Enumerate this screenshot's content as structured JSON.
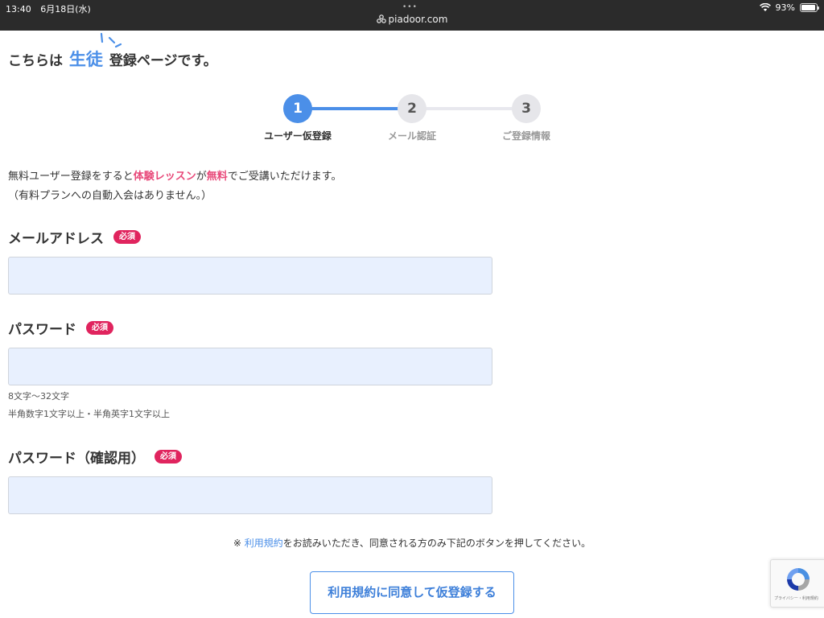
{
  "status_bar": {
    "time": "13:40",
    "date": "6月18日(水)",
    "dots": "•••",
    "url": "piadoor.com",
    "battery": "93%",
    "battery_level": 0.93
  },
  "heading": {
    "prefix": "こちらは",
    "highlight": "生徒",
    "suffix": "登録ページです。"
  },
  "stepper": {
    "current_step": 1,
    "steps": [
      {
        "number": "1",
        "label": "ユーザー仮登録"
      },
      {
        "number": "2",
        "label": "メール認証"
      },
      {
        "number": "3",
        "label": "ご登録情報"
      }
    ],
    "colors": {
      "active": "#4b8fe8",
      "inactive": "#e6e6ea"
    }
  },
  "intro": {
    "line1_a": "無料ユーザー登録をすると",
    "line1_b": "体験レッスン",
    "line1_c": "が",
    "line1_d": "無料",
    "line1_e": "でご受講いただけます。",
    "line2": "（有料プランへの自動入会はありません。）",
    "accent_color": "#e84a7a"
  },
  "form": {
    "required_badge": "必須",
    "email": {
      "label": "メールアドレス",
      "value": ""
    },
    "password": {
      "label": "パスワード",
      "value": "",
      "hint1": "8文字〜32文字",
      "hint2": "半角数字1文字以上・半角英字1文字以上"
    },
    "password_confirm": {
      "label": "パスワード（確認用）",
      "value": ""
    },
    "terms_prefix": "※ ",
    "terms_link": "利用規約",
    "terms_suffix": "をお読みいただき、同意される方のみ下記のボタンを押してください。",
    "submit_label": "利用規約に同意して仮登録する"
  },
  "recaptcha": {
    "text": "プライバシー・利用規約",
    "icon": "recaptcha-icon"
  }
}
